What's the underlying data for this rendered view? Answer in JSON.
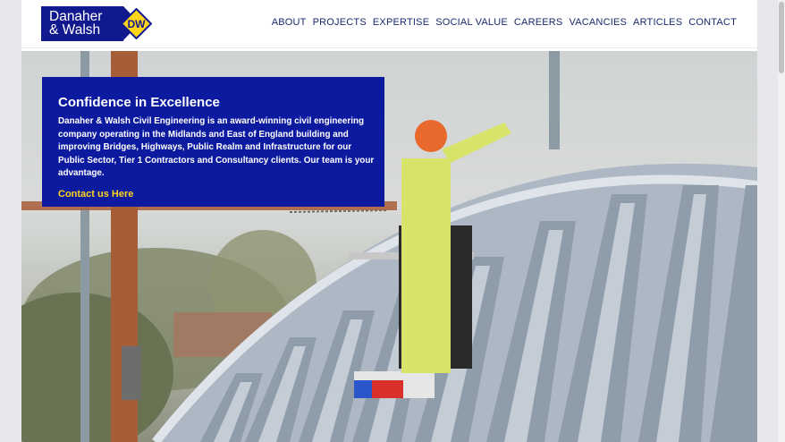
{
  "logo": {
    "line1": "Danaher",
    "line2": "& Walsh",
    "badge": "DW"
  },
  "nav": {
    "items": [
      "ABOUT",
      "PROJECTS",
      "EXPERTISE",
      "SOCIAL VALUE",
      "CAREERS",
      "VACANCIES",
      "ARTICLES",
      "CONTACT"
    ]
  },
  "hero": {
    "title": "Confidence in Excellence",
    "body": "Danaher & Walsh Civil Engineering is an award-winning civil engineering company operating in the Midlands and East of England building and improving Bridges, Highways, Public Realm and Infrastructure for our Public Sector, Tier 1 Contractors and Consultancy clients. Our team is your advantage.",
    "cta": "Contact us Here"
  },
  "colors": {
    "brand_blue": "#0c1aa0",
    "accent_yellow": "#ffd51a",
    "nav_text": "#1a2a6c"
  }
}
